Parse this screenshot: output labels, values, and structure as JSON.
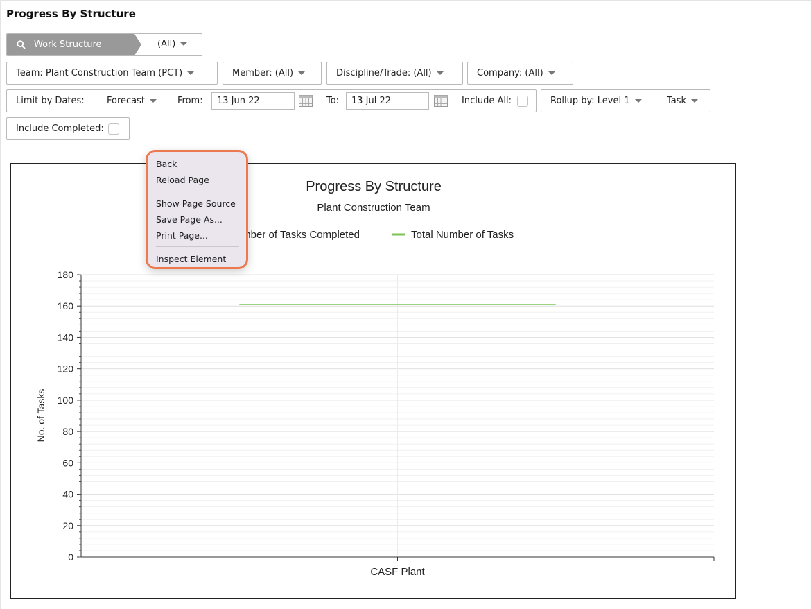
{
  "page": {
    "title": "Progress By Structure"
  },
  "filters": {
    "work_structure": {
      "label": "Work Structure",
      "value": "(All)"
    },
    "team": {
      "label": "Team:",
      "value": "Plant Construction Team (PCT)"
    },
    "member": {
      "label": "Member:",
      "value": "(All)"
    },
    "discipline": {
      "label": "Discipline/Trade:",
      "value": "(All)"
    },
    "company": {
      "label": "Company:",
      "value": "(All)"
    },
    "limit_dates": {
      "label": "Limit by Dates:",
      "value": "Forecast"
    },
    "from": {
      "label": "From:",
      "value": "13 Jun 22"
    },
    "to": {
      "label": "To:",
      "value": "13 Jul 22"
    },
    "include_all": {
      "label": "Include All:",
      "checked": false
    },
    "rollup": {
      "label": "Rollup by:",
      "value": "Level 1",
      "value2": "Task"
    },
    "include_completed": {
      "label": "Include Completed:",
      "checked": false
    }
  },
  "context_menu": {
    "items": [
      "Back",
      "Reload Page",
      "Show Page Source",
      "Save Page As...",
      "Print Page...",
      "Inspect Element"
    ]
  },
  "colors": {
    "total_series": "#7cc35a",
    "menu_border": "#ec7a4e",
    "pill_bg": "#999999"
  },
  "chart_data": {
    "type": "line",
    "title": "Progress By Structure",
    "subtitle": "Plant Construction Team",
    "xlabel": "",
    "ylabel": "No. of Tasks",
    "categories": [
      "CASF Plant"
    ],
    "ylim": [
      0,
      180
    ],
    "yticks": [
      0,
      20,
      40,
      60,
      80,
      100,
      120,
      140,
      160,
      180
    ],
    "grid": true,
    "legend_position": "top",
    "series": [
      {
        "name": "Number of Tasks Completed",
        "values": [
          0
        ],
        "color": "#4a78c2"
      },
      {
        "name": "Total Number of Tasks",
        "values": [
          161
        ],
        "color": "#7cc35a"
      }
    ]
  }
}
